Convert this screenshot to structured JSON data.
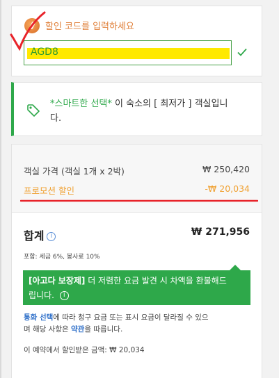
{
  "promo": {
    "label": "할인 코드를 입력하세요",
    "code_value": "AGD8"
  },
  "smart_choice": {
    "highlight": "*스마트한 선택*",
    "text_line1_rest": " 이 숙소의 [ 최저가 ] 객실입니",
    "text_line2": "다."
  },
  "price": {
    "room_label": "객실 가격 (객실 1개 x 2박)",
    "room_value": "₩ 250,420",
    "promo_label": "프로모션 할인",
    "promo_value": "-₩ 20,034",
    "total_label": "합계",
    "total_value": "₩ 271,956",
    "tax_note": "포함: 세금 6%, 봉사료 10%"
  },
  "guarantee": {
    "bold": "[아고다 보장제]",
    "rest": " 더 저렴한 요금 발견 시 차액을 환불해드",
    "line2": "립니다."
  },
  "policy": {
    "link1": "통화 선택",
    "text1": "에 따라 청구 요금 또는 표시 요금이 달라질 수 있으",
    "text2": "며 해당 사항은 ",
    "link2": "약관",
    "text3": "을 따릅니다."
  },
  "savings": "이 예약에서 할인받은 금액: ₩ 20,034",
  "colors": {
    "green": "#2ea84a",
    "orange": "#f0a030",
    "link": "#2e6fc9",
    "highlight": "#ffe900",
    "annotation_red": "#e8232a"
  }
}
